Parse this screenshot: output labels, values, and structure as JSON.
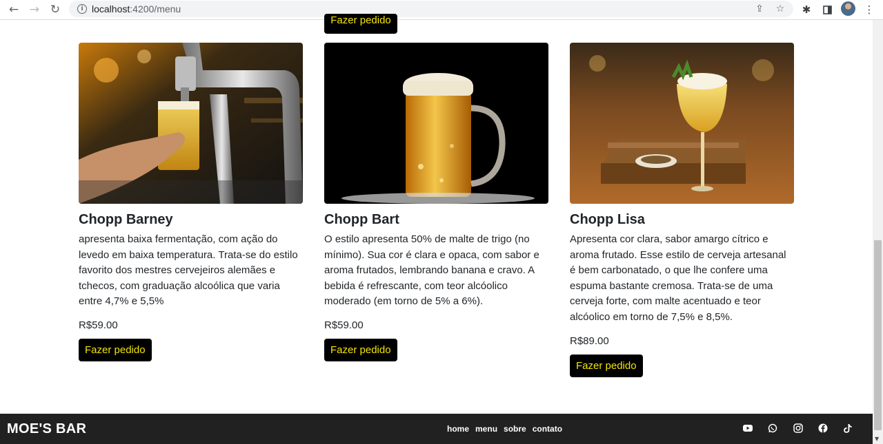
{
  "browser": {
    "url_host": "localhost",
    "url_path": ":4200/menu",
    "back_icon": "arrow-left-icon",
    "forward_icon": "arrow-right-icon",
    "reload_icon": "reload-icon"
  },
  "top_button_label": "Fazer pedido",
  "products": [
    {
      "name": "Chopp Barney",
      "description": "apresenta baixa fermentação, com ação do levedo em baixa temperatura. Trata-se do estilo favorito dos mestres cervejeiros alemães e tchecos, com graduação alcoólica que varia entre 4,7% e 5,5%",
      "price": "R$59.00",
      "button_label": "Fazer pedido"
    },
    {
      "name": "Chopp Bart",
      "description": "O estilo apresenta 50% de malte de trigo (no mínimo). Sua cor é clara e opaca, com sabor e aroma frutados, lembrando banana e cravo. A bebida é refrescante, com teor alcóolico moderado (em torno de 5% a 6%).",
      "price": "R$59.00",
      "button_label": "Fazer pedido"
    },
    {
      "name": "Chopp Lisa",
      "description": "Apresenta cor clara, sabor amargo cítrico e aroma frutado. Esse estilo de cerveja artesanal é bem carbonatado, o que lhe confere uma espuma bastante cremosa. Trata-se de uma cerveja forte, com malte acentuado e teor alcóolico em torno de 7,5% e 8,5%.",
      "price": "R$89.00",
      "button_label": "Fazer pedido"
    }
  ],
  "footer": {
    "brand": "MOE'S BAR",
    "nav": [
      "home",
      "menu",
      "sobre",
      "contato"
    ],
    "social_icons": [
      "youtube-icon",
      "whatsapp-icon",
      "instagram-icon",
      "facebook-icon",
      "tiktok-icon"
    ]
  },
  "colors": {
    "button_bg": "#000000",
    "button_text": "#f5e50a",
    "footer_bg": "#212121"
  }
}
